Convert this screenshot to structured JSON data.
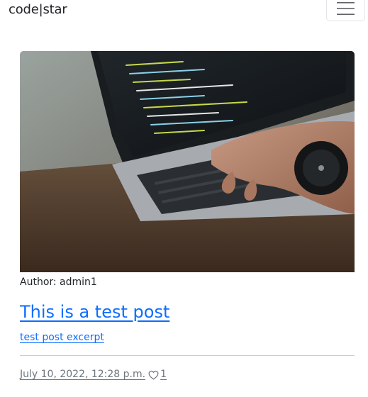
{
  "navbar": {
    "brand": "code|star",
    "toggler_icon": "hamburger-menu-icon"
  },
  "post": {
    "image_alt": "Hands typing code on a laptop",
    "author_line": "Author: admin1",
    "title": "This is a test post",
    "excerpt": "test post excerpt",
    "date": "July 10, 2022, 12:28 p.m.",
    "like_icon": "heart-outline-icon",
    "likes": "1"
  },
  "colors": {
    "link": "#0d6efd",
    "muted": "#6c757d",
    "text": "#212529",
    "divider": "#b9d1ea"
  }
}
